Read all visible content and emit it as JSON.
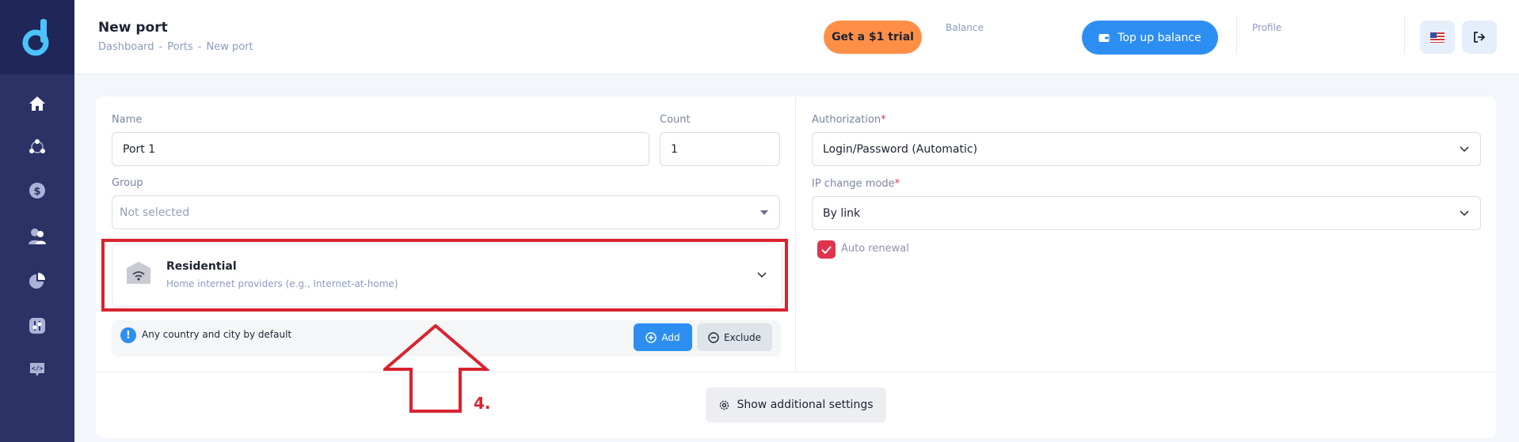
{
  "header": {
    "title": "New port",
    "breadcrumb": [
      "Dashboard",
      "Ports",
      "New port"
    ],
    "trial_button": "Get a $1 trial",
    "balance_label": "Balance",
    "topup_button": "Top up balance",
    "profile_label": "Profile"
  },
  "sidebar": {
    "items": [
      "home-icon",
      "network-icon",
      "dollar-icon",
      "users-icon",
      "pie-chart-icon",
      "sliders-icon",
      "code-icon"
    ]
  },
  "form": {
    "name_label": "Name",
    "name_value": "Port 1",
    "count_label": "Count",
    "count_value": "1",
    "group_label": "Group",
    "group_placeholder": "Not selected",
    "proxy_type": {
      "title": "Residential",
      "subtitle": "Home internet providers (e.g., Internet-at-home)"
    },
    "location_info": "Any country and city by default",
    "add_button": "Add",
    "exclude_button": "Exclude",
    "authorization_label": "Authorization",
    "authorization_value": "Login/Password (Automatic)",
    "ip_mode_label": "IP change mode",
    "ip_mode_value": "By link",
    "required_mark": "*",
    "auto_renewal_label": "Auto renewal",
    "auto_renewal_checked": true,
    "additional_settings_button": "Show additional settings"
  },
  "annotation": {
    "step": "4."
  },
  "colors": {
    "sidebar": "#2a3266",
    "accent_blue": "#2d8ef2",
    "accent_orange": "#ff8f47",
    "highlight_red": "#d7232f",
    "checkbox_red": "#e0334c"
  }
}
